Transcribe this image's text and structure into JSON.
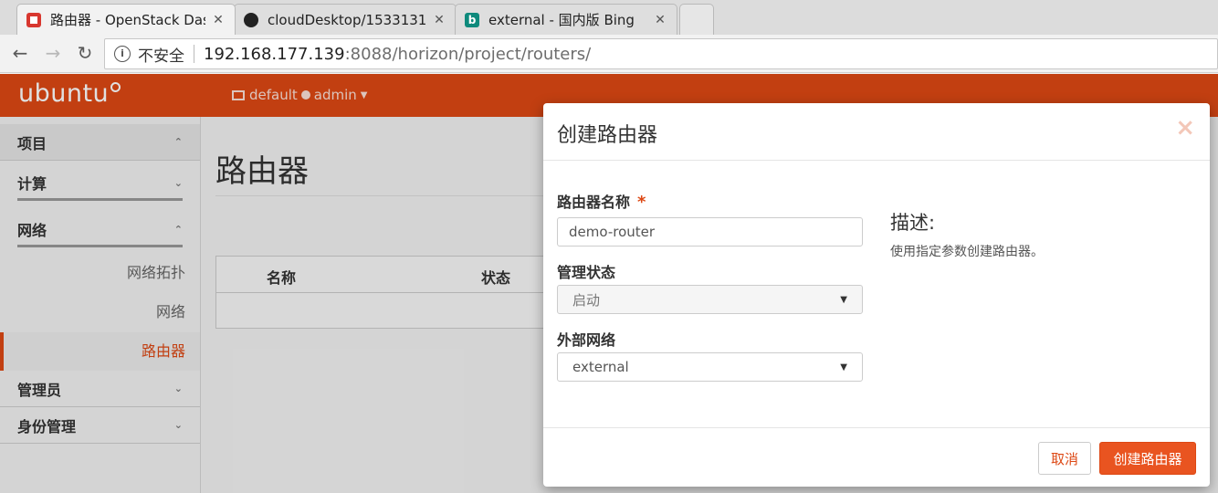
{
  "browser": {
    "tabs": [
      {
        "title": "路由器 - OpenStack Das",
        "active": true,
        "icon": "openstack-icon"
      },
      {
        "title": "cloudDesktop/1533131",
        "active": false,
        "icon": "github-icon"
      },
      {
        "title": "external - 国内版 Bing",
        "active": false,
        "icon": "bing-icon"
      }
    ],
    "close_glyph": "✕",
    "nav": {
      "back": "←",
      "forward": "→",
      "reload": "↻"
    },
    "address": {
      "security_label": "不安全",
      "host": "192.168.177.139",
      "rest": ":8088/horizon/project/routers/"
    }
  },
  "header": {
    "logo": "ubuntu",
    "project": "default",
    "user": "admin"
  },
  "sidebar": {
    "sections": [
      {
        "label": "项目",
        "chevron": "⌃"
      },
      {
        "label": "计算",
        "chevron": "⌄"
      },
      {
        "label": "网络",
        "chevron": "⌃"
      },
      {
        "label": "管理员",
        "chevron": "⌄"
      },
      {
        "label": "身份管理",
        "chevron": "⌄"
      }
    ],
    "network_items": [
      "网络拓扑",
      "网络",
      "路由器"
    ],
    "active_item": "路由器"
  },
  "main": {
    "title": "路由器",
    "table_headers": [
      "名称",
      "状态"
    ]
  },
  "modal": {
    "title": "创建路由器",
    "close": "×",
    "fields": {
      "name_label": "路由器名称",
      "required_mark": "*",
      "name_value": "demo-router",
      "admin_state_label": "管理状态",
      "admin_state_value": "启动",
      "external_network_label": "外部网络",
      "external_network_value": "external"
    },
    "description_title": "描述:",
    "description_text": "使用指定参数创建路由器。",
    "buttons": {
      "cancel": "取消",
      "submit": "创建路由器"
    }
  },
  "colors": {
    "brand": "#dd4814",
    "primary_button": "#e95420"
  }
}
